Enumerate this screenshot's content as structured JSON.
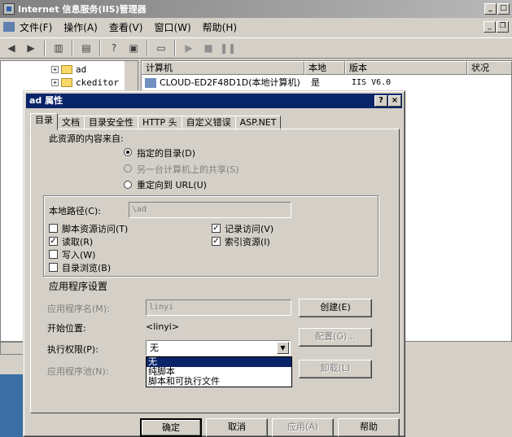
{
  "window": {
    "title": "Internet 信息服务(IIS)管理器",
    "min": "_",
    "max": "□",
    "close": "×"
  },
  "menu": [
    "文件(F)",
    "操作(A)",
    "查看(V)",
    "窗口(W)",
    "帮助(H)"
  ],
  "mdi": {
    "min": "_",
    "restore": "❐"
  },
  "tree": {
    "items": [
      {
        "label": "ad"
      },
      {
        "label": "ckeditor"
      }
    ]
  },
  "list": {
    "headers": [
      "计算机",
      "本地",
      "版本",
      "状况"
    ],
    "rows": [
      {
        "computer": "CLOUD-ED2F48D1D(本地计算机)",
        "local": "是",
        "version": "IIS V6.0",
        "status": ""
      }
    ]
  },
  "dialog": {
    "title": "ad 属性",
    "help": "?",
    "close": "×",
    "tabs": [
      "目录",
      "文档",
      "目录安全性",
      "HTTP 头",
      "自定义错误",
      "ASP.NET"
    ],
    "content_source_label": "此资源的内容来自:",
    "radio_options": [
      "指定的目录(D)",
      "另一台计算机上的共享(S)",
      "重定向到 URL(U)"
    ],
    "local_path_label": "本地路径(C):",
    "local_path_value": "\\ad",
    "checkboxes_left": [
      {
        "label": "脚本资源访问(T)",
        "checked": false
      },
      {
        "label": "读取(R)",
        "checked": true
      },
      {
        "label": "写入(W)",
        "checked": false
      },
      {
        "label": "目录浏览(B)",
        "checked": false
      }
    ],
    "checkboxes_right": [
      {
        "label": "记录访问(V)",
        "checked": true
      },
      {
        "label": "索引资源(I)",
        "checked": true
      }
    ],
    "app_settings_label": "应用程序设置",
    "app_name_label": "应用程序名(M):",
    "app_name_value": "linyi",
    "create_button": "创建(E)",
    "start_point_label": "开始位置:",
    "start_point_value": "<linyi>",
    "config_button": "配置(G)...",
    "exec_perm_label": "执行权限(P):",
    "exec_perm_value": "无",
    "exec_perm_options": [
      "无",
      "纯脚本",
      "脚本和可执行文件"
    ],
    "app_pool_label": "应用程序池(N):",
    "unload_button": "卸载(L)",
    "ok": "确定",
    "cancel": "取消",
    "apply": "应用(A)",
    "help_button": "帮助"
  }
}
